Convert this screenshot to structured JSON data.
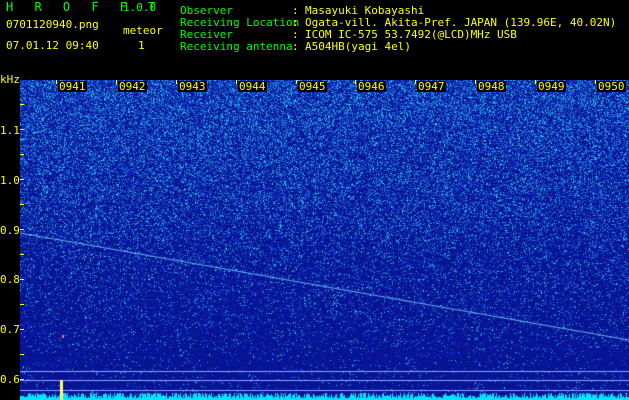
{
  "header": {
    "app_title": "H R O F F T",
    "version": "1.0.0",
    "filename": "0701120940.png",
    "datetime": "07.01.12 09:40",
    "meteor_label": "meteor",
    "meteor_count": "1",
    "info": [
      {
        "label": "Observer",
        "colon": ":",
        "value": "Masayuki Kobayashi"
      },
      {
        "label": "Receiving Location",
        "colon": ":",
        "value": "Ogata-vill. Akita-Pref. JAPAN (139.96E, 40.02N)"
      },
      {
        "label": "Receiver",
        "colon": ":",
        "value": "ICOM IC-575 53.7492(@LCD)MHz USB"
      },
      {
        "label": "Receiving antenna",
        "colon": ":",
        "value": "A504HB(yagi 4el)"
      }
    ]
  },
  "y_axis": {
    "unit": "kHz",
    "ticks": [
      "1.1",
      "1.0",
      "0.9",
      "0.8",
      "0.7",
      "0.6"
    ]
  },
  "x_axis": {
    "ticks": [
      "0941",
      "0942",
      "0943",
      "0944",
      "0945",
      "0946",
      "0947",
      "0948",
      "0949",
      "0950"
    ]
  },
  "colors": {
    "label_text": "#00ff00",
    "value_text": "#ffff00",
    "spectrogram_bg": "#0a1a9a",
    "noise_floor": "#00e5ff"
  }
}
